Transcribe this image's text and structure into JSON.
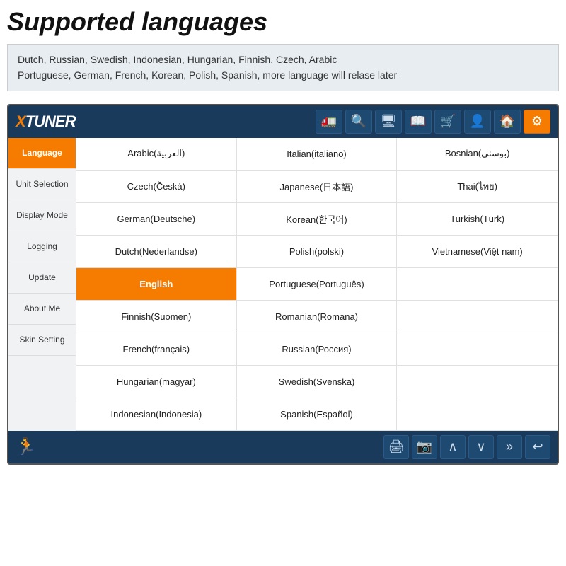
{
  "page": {
    "title": "Supported languages",
    "subtitle": "Dutch, Russian, Swedish, Indonesian, Hungarian, Finnish, Czech, Arabic\nPortuguese, German, French, Korean, Polish, Spanish, more language will relase later"
  },
  "header": {
    "logo_text": "XTUNER",
    "icons": [
      {
        "name": "truck-icon",
        "symbol": "🚛",
        "active": false
      },
      {
        "name": "search-icon",
        "symbol": "🔍",
        "active": false
      },
      {
        "name": "display-icon",
        "symbol": "🖥",
        "active": false
      },
      {
        "name": "book-icon",
        "symbol": "📖",
        "active": false
      },
      {
        "name": "cart-icon",
        "symbol": "🛒",
        "active": false
      },
      {
        "name": "user-icon",
        "symbol": "👤",
        "active": false
      },
      {
        "name": "home-icon",
        "symbol": "🏠",
        "active": false
      },
      {
        "name": "settings-icon",
        "symbol": "⚙",
        "active": true
      }
    ]
  },
  "sidebar": {
    "items": [
      {
        "label": "Language",
        "active": true
      },
      {
        "label": "Unit Selection",
        "active": false
      },
      {
        "label": "Display Mode",
        "active": false
      },
      {
        "label": "Logging",
        "active": false
      },
      {
        "label": "Update",
        "active": false
      },
      {
        "label": "About Me",
        "active": false
      },
      {
        "label": "Skin Setting",
        "active": false
      }
    ]
  },
  "languages": [
    {
      "label": "Arabic(العربية)",
      "selected": false
    },
    {
      "label": "Italian(italiano)",
      "selected": false
    },
    {
      "label": "Bosnian(بوسنی)",
      "selected": false
    },
    {
      "label": "Czech(Česká)",
      "selected": false
    },
    {
      "label": "Japanese(日本語)",
      "selected": false
    },
    {
      "label": "Thai(ไทย)",
      "selected": false
    },
    {
      "label": "German(Deutsche)",
      "selected": false
    },
    {
      "label": "Korean(한국어)",
      "selected": false
    },
    {
      "label": "Turkish(Türk)",
      "selected": false
    },
    {
      "label": "Dutch(Nederlandse)",
      "selected": false
    },
    {
      "label": "Polish(polski)",
      "selected": false
    },
    {
      "label": "Vietnamese(Việt nam)",
      "selected": false
    },
    {
      "label": "English",
      "selected": true
    },
    {
      "label": "Portuguese(Português)",
      "selected": false
    },
    {
      "label": "",
      "selected": false,
      "empty": true
    },
    {
      "label": "Finnish(Suomen)",
      "selected": false
    },
    {
      "label": "Romanian(Romana)",
      "selected": false
    },
    {
      "label": "",
      "selected": false,
      "empty": true
    },
    {
      "label": "French(français)",
      "selected": false
    },
    {
      "label": "Russian(Россия)",
      "selected": false
    },
    {
      "label": "",
      "selected": false,
      "empty": true
    },
    {
      "label": "Hungarian(magyar)",
      "selected": false
    },
    {
      "label": "Swedish(Svenska)",
      "selected": false
    },
    {
      "label": "",
      "selected": false,
      "empty": true
    },
    {
      "label": "Indonesian(Indonesia)",
      "selected": false
    },
    {
      "label": "Spanish(Español)",
      "selected": false
    },
    {
      "label": "",
      "selected": false,
      "empty": true
    }
  ],
  "footer": {
    "icons": [
      {
        "name": "run-icon",
        "symbol": "🏃",
        "left": true
      },
      {
        "name": "print-icon",
        "symbol": "🖨"
      },
      {
        "name": "camera-icon",
        "symbol": "📷"
      },
      {
        "name": "up-icon",
        "symbol": "∧"
      },
      {
        "name": "down-icon",
        "symbol": "∨"
      },
      {
        "name": "forward-icon",
        "symbol": "»"
      },
      {
        "name": "back-icon",
        "symbol": "↩"
      }
    ]
  }
}
